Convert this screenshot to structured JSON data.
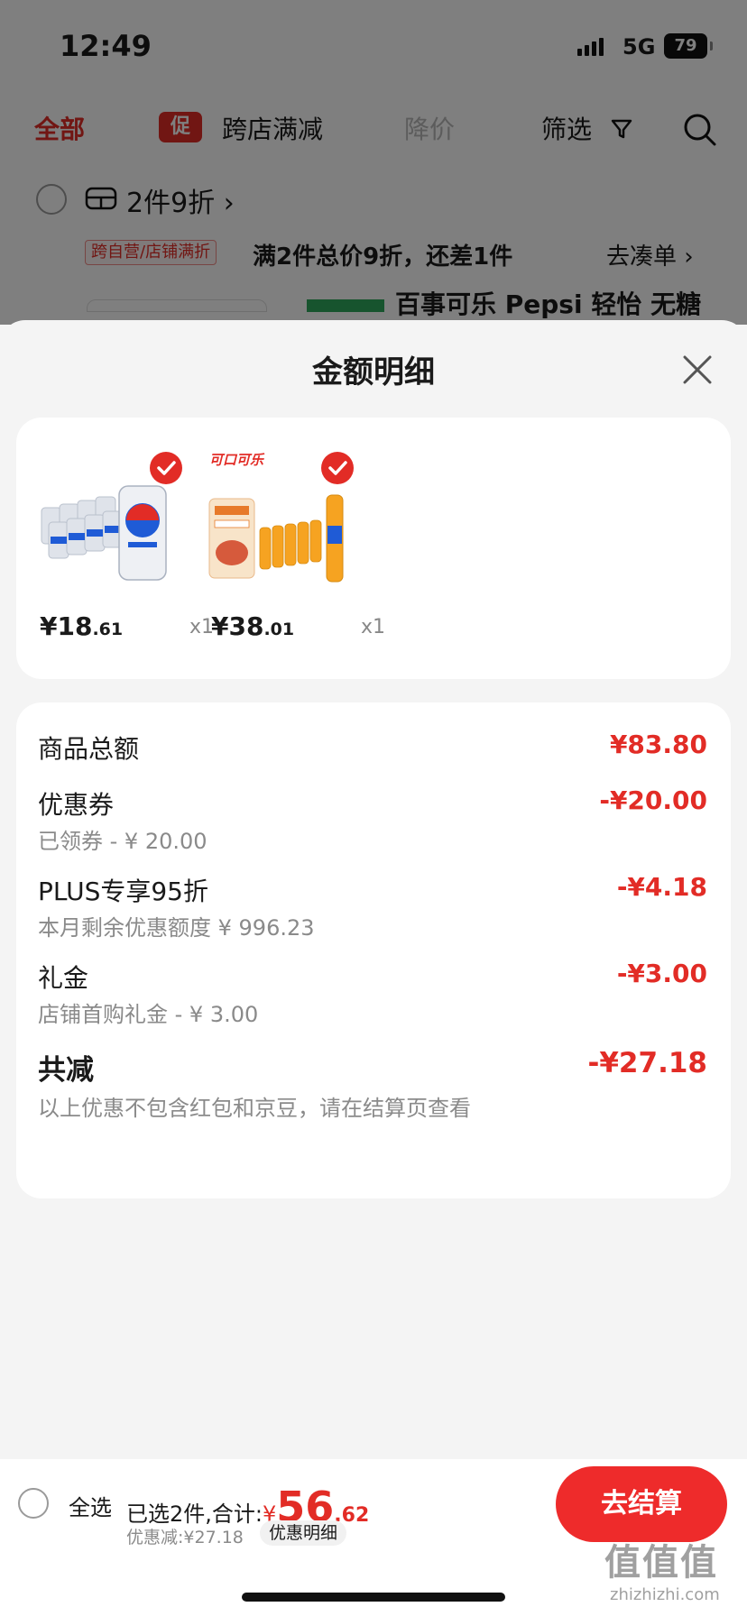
{
  "status_bar": {
    "time": "12:49",
    "network": "5G",
    "battery": "79"
  },
  "tabs": {
    "all": "全部",
    "promo_badge": "促",
    "cross_store": "跨店满减",
    "price_drop": "降价",
    "filter": "筛选"
  },
  "group": {
    "title": "2件9折 ›",
    "promo_tag": "跨自营/店铺满折",
    "promo_text": "满2件总价9折，还差1件",
    "go_link": "去凑单 ›",
    "peek_text": "百事可乐 Pepsi 轻怡 无糖"
  },
  "sheet": {
    "title": "金额明细",
    "products": [
      {
        "name": "pepsi-light-cans",
        "price_int": "¥18",
        "price_dec": ".61",
        "qty": "x1"
      },
      {
        "name": "fanta-bottles",
        "price_int": "¥38",
        "price_dec": ".01",
        "qty": "x1",
        "brand_label": "可口可乐"
      }
    ],
    "details": {
      "goods_total_label": "商品总额",
      "goods_total_value": "¥83.80",
      "coupon_label": "优惠券",
      "coupon_sub": "已领券 - ¥ 20.00",
      "coupon_value": "-¥20.00",
      "plus_label": "PLUS专享95折",
      "plus_sub": "本月剩余优惠额度 ¥ 996.23",
      "plus_value": "-¥4.18",
      "gift_label": "礼金",
      "gift_sub": "店铺首购礼金 - ¥ 3.00",
      "gift_value": "-¥3.00",
      "total_label": "共减",
      "total_value": "-¥27.18",
      "note": "以上优惠不包含红包和京豆，请在结算页查看"
    }
  },
  "bottom_bar": {
    "select_all": "全选",
    "selected_text": "已选2件,合计:",
    "currency": "¥",
    "total_int": "56",
    "total_dec": ".62",
    "saved": "优惠减:¥27.18",
    "promo_detail": "优惠明细",
    "checkout": "去结算"
  },
  "watermark": {
    "main": "值值值",
    "sub": "zhizhizhi.com"
  },
  "colors": {
    "accent": "#e22c26",
    "background": "#f4f4f4"
  }
}
